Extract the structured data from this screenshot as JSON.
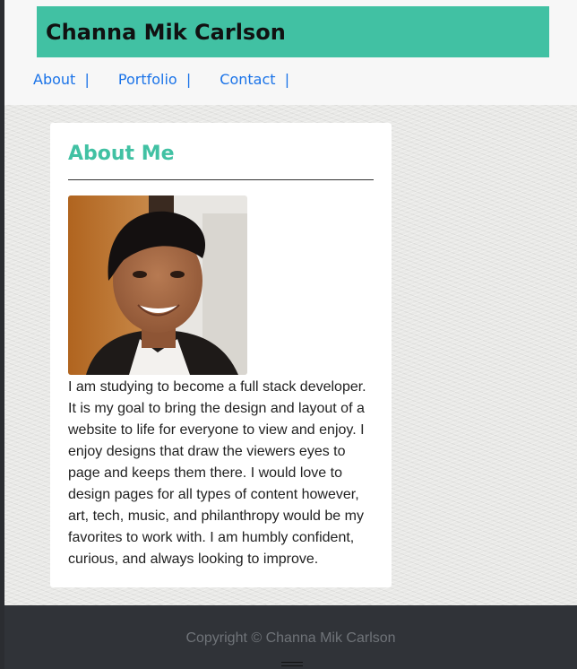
{
  "site": {
    "title": "Channa Mik Carlson",
    "accent_color": "#41c1a3",
    "link_color": "#1a73e8"
  },
  "nav": {
    "items": [
      {
        "label": "About  |"
      },
      {
        "label": "Portfolio  |"
      },
      {
        "label": "Contact  |"
      }
    ]
  },
  "about": {
    "heading": "About Me",
    "photo_icon": "profile-photo",
    "body": "I am studying to become a full stack developer. It is my goal to bring the design and layout of a website to life for everyone to view and enjoy. I enjoy designs that draw the viewers eyes to page and keeps them there. I would love to design pages for all types of content however, art, tech, music, and philanthropy would be my favorites to work with. I am humbly confident, curious, and always looking to improve."
  },
  "footer": {
    "copyright": "Copyright © Channa Mik Carlson"
  }
}
